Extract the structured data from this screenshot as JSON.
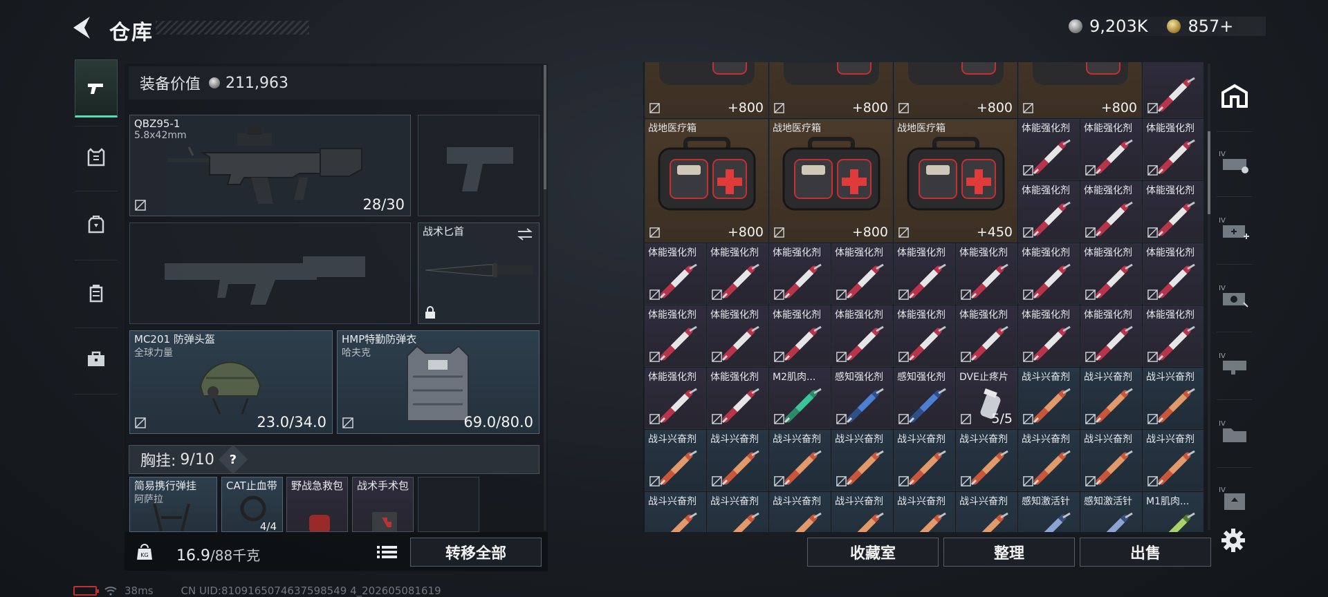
{
  "header": {
    "title": "仓库",
    "silver_amount": "9,203K",
    "gold_amount": "857+"
  },
  "left_nav": {
    "items": [
      "pistol-icon",
      "armor-vest-icon",
      "backpack-icon",
      "chest-rig-icon",
      "toolbox-icon"
    ],
    "active": 0
  },
  "equipment": {
    "value_label": "装备价值",
    "value": "211,963",
    "primary_weapon": {
      "name": "QBZ95-1",
      "caliber": "5.8x42mm",
      "ammo": "28/30"
    },
    "melee": {
      "name": "战术匕首"
    },
    "helmet": {
      "name": "MC201 防弹头盔",
      "brand": "全球力量",
      "durability": "23.0/34.0"
    },
    "armor": {
      "name": "HMP特勤防弹衣",
      "brand": "哈夫克",
      "durability": "69.0/80.0"
    }
  },
  "chest_rig": {
    "label": "胸挂:",
    "capacity": "9/10",
    "help": "?",
    "items": [
      {
        "name": "简易携行弹挂",
        "brand": "阿萨拉"
      },
      {
        "name": "CAT止血带",
        "count": "4/4"
      },
      {
        "name": "野战急救包"
      },
      {
        "name": "战术手术包"
      }
    ]
  },
  "weight": {
    "current": "16.9",
    "max": "/88千克"
  },
  "buttons": {
    "transfer_all": "转移全部",
    "collection_room": "收藏室",
    "organize": "整理",
    "sell": "出售"
  },
  "stash_grid": {
    "top_row_counts": [
      "+800",
      "+800",
      "+800",
      "+800"
    ],
    "medkits": [
      {
        "name": "战地医疗箱",
        "count": "+800"
      },
      {
        "name": "战地医疗箱",
        "count": "+800"
      },
      {
        "name": "战地医疗箱",
        "count": "+450"
      }
    ],
    "item_name_stim": "体能强化剂",
    "item_name_combat": "战斗兴奋剂",
    "row5": [
      "体能强化剂",
      "体能强化剂",
      "M2肌肉...",
      "感知强化剂",
      "感知强化剂",
      "DVE止疼片",
      "战斗兴奋剂",
      "战斗兴奋剂",
      "战斗兴奋剂"
    ],
    "row7": [
      "战斗兴奋剂",
      "战斗兴奋剂",
      "战斗兴奋剂",
      "战斗兴奋剂",
      "战斗兴奋剂",
      "战斗兴奋剂",
      "感知激活针",
      "感知激活针",
      "M1肌肉..."
    ],
    "dve_count": "5/5"
  },
  "status": {
    "ping": "38ms",
    "uid": "CN UID:8109165074637598549 4_202605081619"
  },
  "colors": {
    "accent": "#4fe0b4",
    "stim_red": "#b8344a",
    "combat_orange": "#c9553a"
  }
}
